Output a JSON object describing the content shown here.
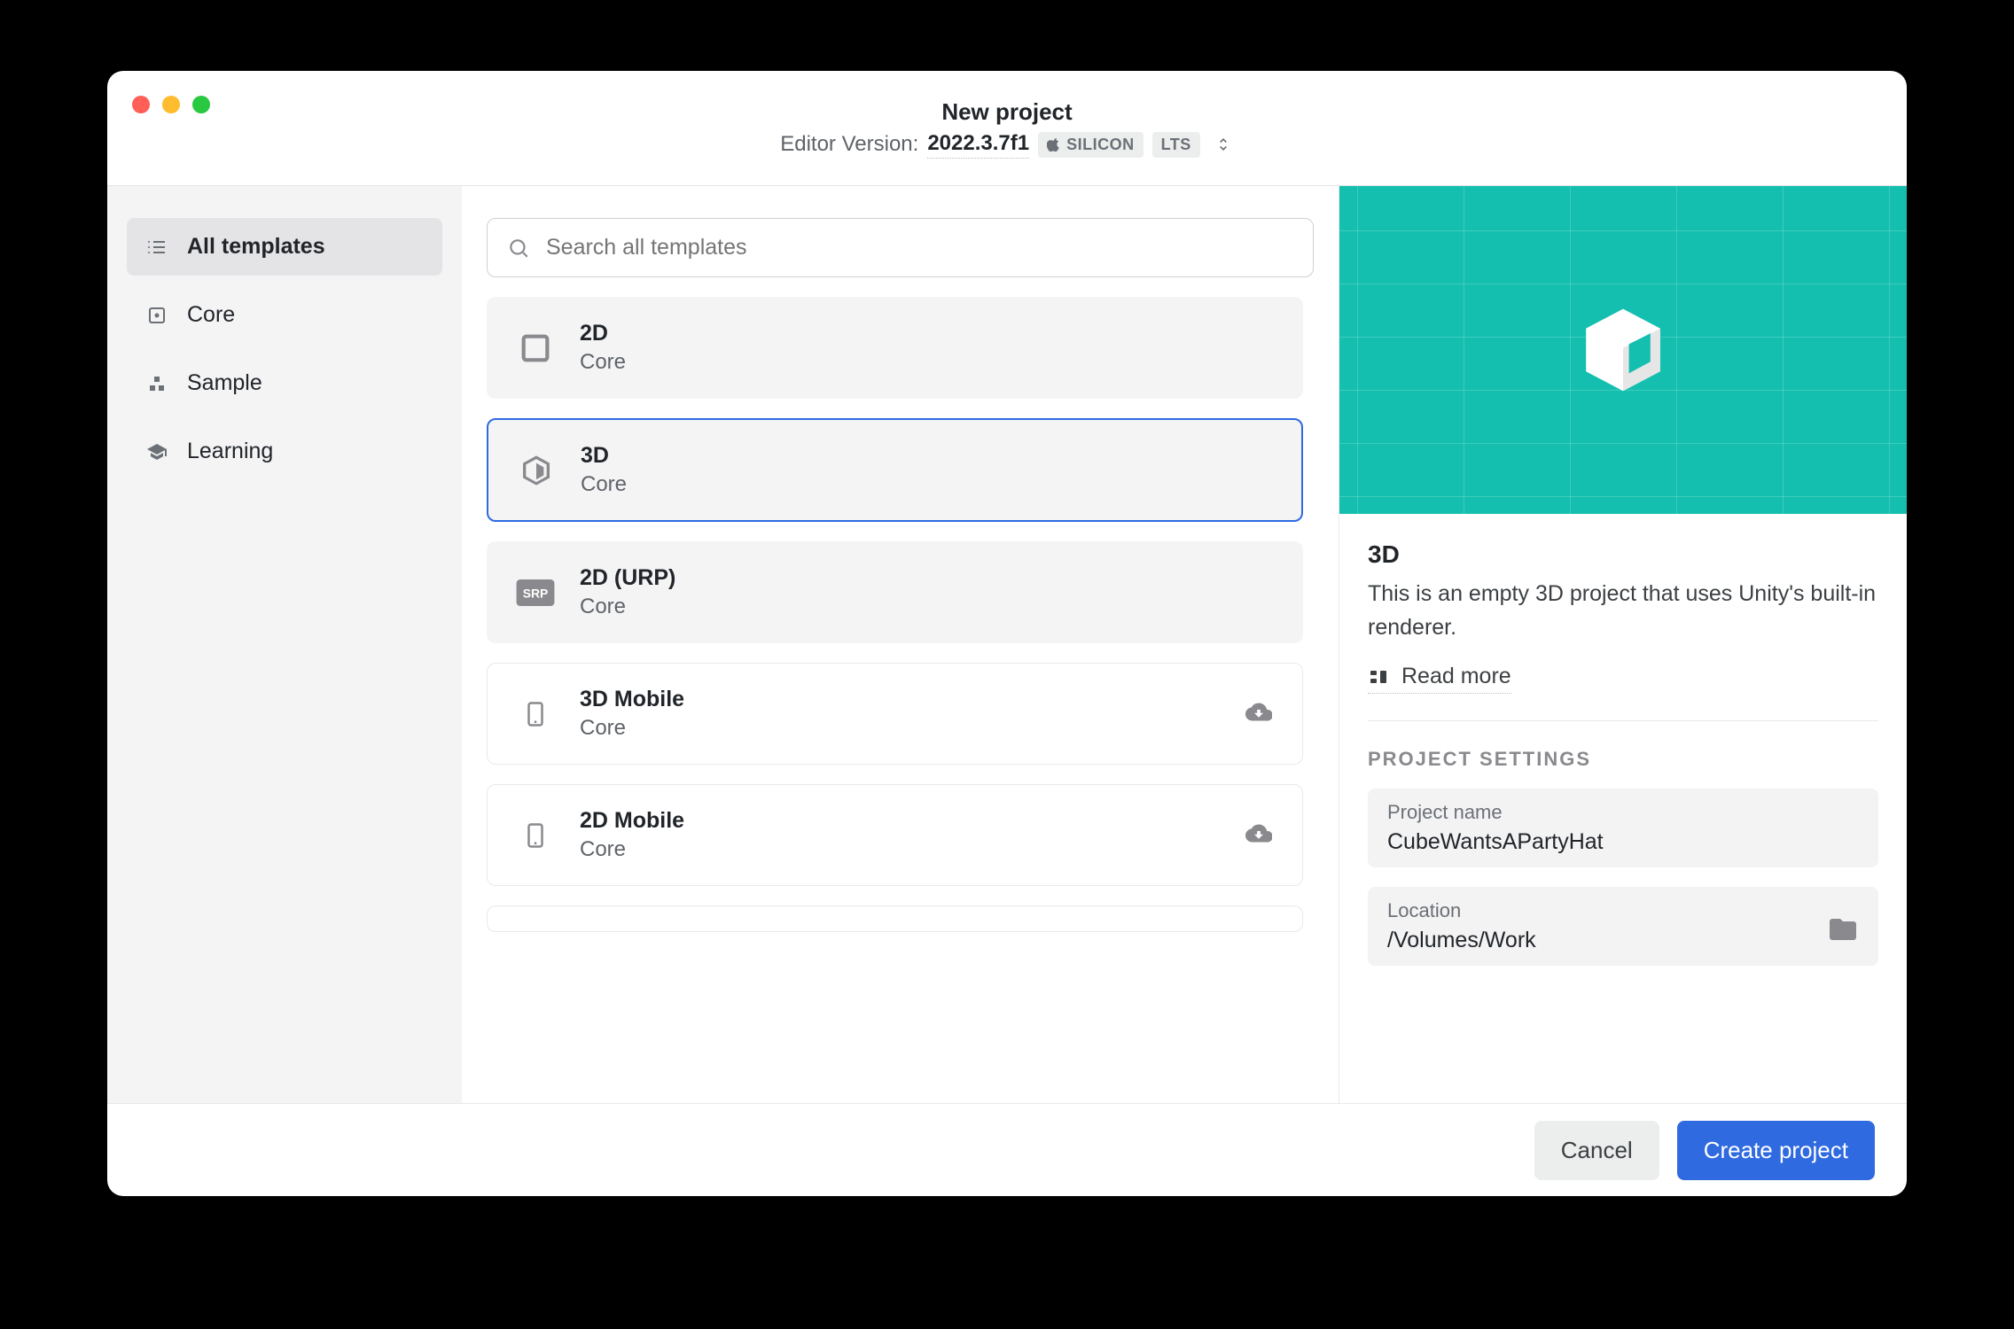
{
  "window": {
    "title": "New project",
    "editor_version_label": "Editor Version:",
    "editor_version": "2022.3.7f1",
    "arch_badge": "SILICON",
    "lts_badge": "LTS"
  },
  "sidebar": {
    "items": [
      {
        "label": "All templates",
        "icon": "list-icon",
        "active": true
      },
      {
        "label": "Core",
        "icon": "square-dot-icon",
        "active": false
      },
      {
        "label": "Sample",
        "icon": "blocks-icon",
        "active": false
      },
      {
        "label": "Learning",
        "icon": "graduation-icon",
        "active": false
      }
    ]
  },
  "search": {
    "placeholder": "Search all templates"
  },
  "templates": [
    {
      "name": "2D",
      "category": "Core",
      "icon": "square",
      "download": false,
      "selected": false,
      "style": "gray"
    },
    {
      "name": "3D",
      "category": "Core",
      "icon": "cube",
      "download": false,
      "selected": true,
      "style": "gray"
    },
    {
      "name": "2D (URP)",
      "category": "Core",
      "icon": "srp",
      "download": false,
      "selected": false,
      "style": "gray"
    },
    {
      "name": "3D Mobile",
      "category": "Core",
      "icon": "phone",
      "download": true,
      "selected": false,
      "style": "white"
    },
    {
      "name": "2D Mobile",
      "category": "Core",
      "icon": "phone",
      "download": true,
      "selected": false,
      "style": "white"
    }
  ],
  "details": {
    "title": "3D",
    "description": "This is an empty 3D project that uses Unity's built-in renderer.",
    "read_more": "Read more",
    "section_title": "PROJECT SETTINGS",
    "project_name_label": "Project name",
    "project_name_value": "CubeWantsAPartyHat",
    "location_label": "Location",
    "location_value": "/Volumes/Work"
  },
  "footer": {
    "cancel": "Cancel",
    "create": "Create project"
  }
}
